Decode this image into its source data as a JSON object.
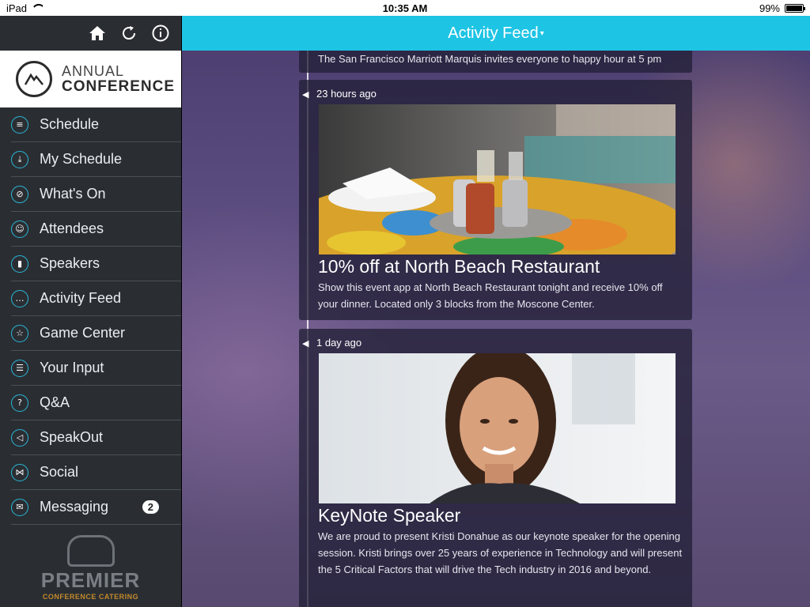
{
  "status": {
    "device": "iPad",
    "time": "10:35 AM",
    "battery": "99%",
    "battery_level": 0.99
  },
  "sidebar": {
    "icons": [
      "home-icon",
      "refresh-icon",
      "info-icon"
    ],
    "logo": {
      "line1": "ANNUAL",
      "line2": "CONFERENCE"
    },
    "items": [
      {
        "label": "Schedule",
        "icon": "≡"
      },
      {
        "label": "My Schedule",
        "icon": "⤓"
      },
      {
        "label": "What's On",
        "icon": "⊘"
      },
      {
        "label": "Attendees",
        "icon": "☺"
      },
      {
        "label": "Speakers",
        "icon": "▮"
      },
      {
        "label": "Activity Feed",
        "icon": "…"
      },
      {
        "label": "Game Center",
        "icon": "☆"
      },
      {
        "label": "Your Input",
        "icon": "☰"
      },
      {
        "label": "Q&A",
        "icon": "?"
      },
      {
        "label": "SpeakOut",
        "icon": "◁"
      },
      {
        "label": "Social",
        "icon": "⋈"
      },
      {
        "label": "Messaging",
        "icon": "✉",
        "badge": "2"
      }
    ],
    "sponsor": {
      "name": "PREMIER",
      "tagline": "CONFERENCE CATERING"
    }
  },
  "header": {
    "title": "Activity Feed",
    "caret": "▾"
  },
  "feed": {
    "partial_text": "The San Francisco Marriott Marquis invites everyone to happy hour at 5 pm",
    "posts": [
      {
        "time": "23 hours ago",
        "title": "10% off at North Beach Restaurant",
        "body": "Show this event app at North Beach Restaurant tonight and receive 10% off your dinner. Located only 3 blocks from the Moscone Center."
      },
      {
        "time": "1 day ago",
        "title": "KeyNote Speaker",
        "body": "We are proud to present Kristi Donahue as our keynote speaker for the opening session. Kristi brings over 25 years of experience in Technology and will present the 5 Critical Factors that will drive the Tech industry in 2016 and beyond."
      }
    ]
  },
  "colors": {
    "accent": "#1ec4e4",
    "sidebar_bg": "#2a2e33"
  }
}
